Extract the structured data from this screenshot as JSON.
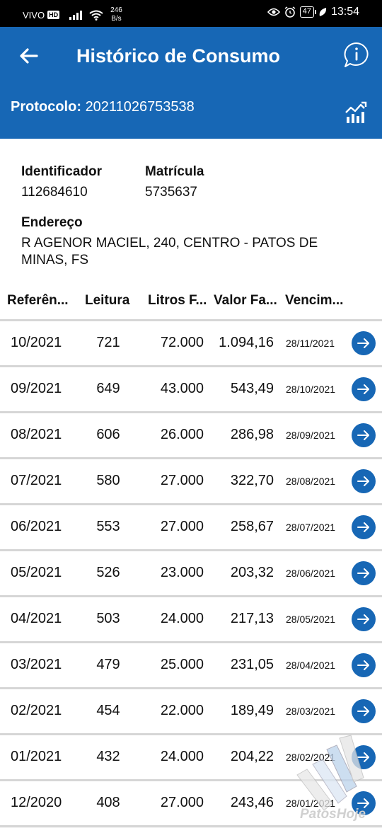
{
  "status_bar": {
    "carrier": "VIVO",
    "hd": "HD",
    "speed_value": "246",
    "speed_unit": "B/s",
    "battery": "47",
    "time": "13:54"
  },
  "header": {
    "title": "Histórico de Consumo",
    "protocol_label": "Protocolo:",
    "protocol_value": "20211026753538"
  },
  "details": {
    "identificador_label": "Identificador",
    "identificador_value": "112684610",
    "matricula_label": "Matrícula",
    "matricula_value": "5735637",
    "endereco_label": "Endereço",
    "endereco_line1": "R AGENOR MACIEL, 240, CENTRO - PATOS DE",
    "endereco_line2": "MINAS, FS"
  },
  "table": {
    "columns": [
      "Referên...",
      "Leitura",
      "Litros F...",
      "Valor Fa...",
      "Vencim..."
    ],
    "rows": [
      {
        "ref": "10/2021",
        "leitura": "721",
        "litros": "72.000",
        "valor": "1.094,16",
        "venc": "28/11/2021"
      },
      {
        "ref": "09/2021",
        "leitura": "649",
        "litros": "43.000",
        "valor": "543,49",
        "venc": "28/10/2021"
      },
      {
        "ref": "08/2021",
        "leitura": "606",
        "litros": "26.000",
        "valor": "286,98",
        "venc": "28/09/2021"
      },
      {
        "ref": "07/2021",
        "leitura": "580",
        "litros": "27.000",
        "valor": "322,70",
        "venc": "28/08/2021"
      },
      {
        "ref": "06/2021",
        "leitura": "553",
        "litros": "27.000",
        "valor": "258,67",
        "venc": "28/07/2021"
      },
      {
        "ref": "05/2021",
        "leitura": "526",
        "litros": "23.000",
        "valor": "203,32",
        "venc": "28/06/2021"
      },
      {
        "ref": "04/2021",
        "leitura": "503",
        "litros": "24.000",
        "valor": "217,13",
        "venc": "28/05/2021"
      },
      {
        "ref": "03/2021",
        "leitura": "479",
        "litros": "25.000",
        "valor": "231,05",
        "venc": "28/04/2021"
      },
      {
        "ref": "02/2021",
        "leitura": "454",
        "litros": "22.000",
        "valor": "189,49",
        "venc": "28/03/2021"
      },
      {
        "ref": "01/2021",
        "leitura": "432",
        "litros": "24.000",
        "valor": "204,22",
        "venc": "28/02/2021"
      },
      {
        "ref": "12/2020",
        "leitura": "408",
        "litros": "27.000",
        "valor": "243,46",
        "venc": "28/01/2021"
      }
    ]
  },
  "watermark": "PatosHoje",
  "icons": {
    "back": "arrow-left-icon",
    "info": "info-bubble-icon",
    "chart": "chart-icon",
    "row_action": "arrow-right-icon"
  },
  "colors": {
    "primary": "#1767b5",
    "status_bar": "#000000",
    "background": "#f2f2f2"
  }
}
